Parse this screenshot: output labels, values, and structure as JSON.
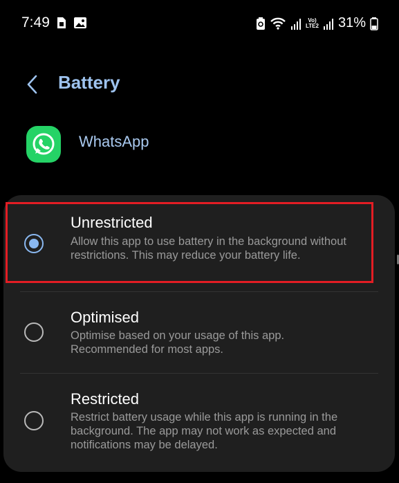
{
  "status_bar": {
    "time": "7:49",
    "left_icons": [
      "sim-card-icon",
      "image-icon"
    ],
    "right_icons": [
      "battery-saver-icon",
      "wifi-icon",
      "signal-icon",
      "volte-icon",
      "signal-icon"
    ],
    "lte_label_top": "Vo)",
    "lte_label_bottom": "LTE2",
    "battery_percent": "31%"
  },
  "header": {
    "title": "Battery",
    "back_icon": "chevron-left-icon"
  },
  "app": {
    "name": "WhatsApp",
    "icon": "whatsapp-icon"
  },
  "options": [
    {
      "title": "Unrestricted",
      "description": "Allow this app to use battery in the background without restrictions. This may reduce your battery life.",
      "selected": true
    },
    {
      "title": "Optimised",
      "description": "Optimise based on your usage of this app. Recommended for most apps.",
      "selected": false
    },
    {
      "title": "Restricted",
      "description": "Restrict battery usage while this app is running in the background. The app may not work as expected and notifications may be delayed.",
      "selected": false
    }
  ],
  "colors": {
    "accent": "#8ab8f0",
    "title": "#9ec3ef",
    "card": "#1f1f1f",
    "highlight": "#e31d24",
    "whatsapp": "#25d366"
  }
}
